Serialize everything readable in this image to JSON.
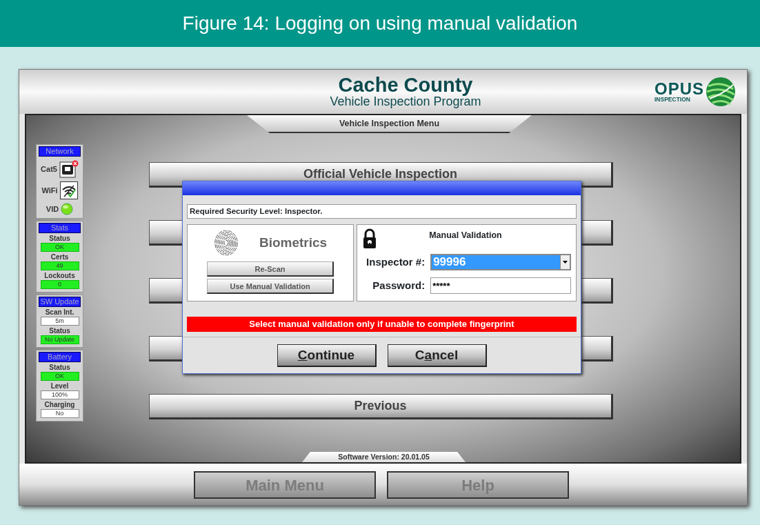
{
  "caption": "Figure 14: Logging on using manual validation",
  "header": {
    "title": "Cache County",
    "subtitle": "Vehicle Inspection Program",
    "logo_text": "OPUS",
    "logo_subtext": "INSPECTION"
  },
  "menu_title": "Vehicle Inspection Menu",
  "side_panel": [
    {
      "title": "Network",
      "rows": [
        {
          "kind": "port",
          "label": "Cat5",
          "error": true
        },
        {
          "kind": "wifi",
          "label": "WiFi",
          "connected": true
        },
        {
          "kind": "led",
          "label": "VID",
          "on": true
        }
      ]
    },
    {
      "title": "Stats",
      "rows": [
        {
          "kind": "value",
          "label": "Status",
          "value": "OK",
          "highlight": true
        },
        {
          "kind": "value",
          "label": "Certs",
          "value": "49",
          "highlight": true
        },
        {
          "kind": "value",
          "label": "Lockouts",
          "value": "0",
          "highlight": true
        }
      ]
    },
    {
      "title": "SW Update",
      "rows": [
        {
          "kind": "value",
          "label": "Scan Int.",
          "value": "5m",
          "highlight": false
        },
        {
          "kind": "value",
          "label": "Status",
          "value": "No Update",
          "highlight": true
        }
      ]
    },
    {
      "title": "Battery",
      "rows": [
        {
          "kind": "value",
          "label": "Status",
          "value": "OK",
          "highlight": true
        },
        {
          "kind": "value",
          "label": "Level",
          "value": "100%",
          "highlight": false
        },
        {
          "kind": "value",
          "label": "Charging",
          "value": "No",
          "highlight": false
        }
      ]
    }
  ],
  "menu_buttons": [
    {
      "kind": "labeled",
      "label": "Official Vehicle Inspection"
    },
    {
      "kind": "blank"
    },
    {
      "kind": "blank"
    },
    {
      "kind": "blank"
    },
    {
      "kind": "labeled",
      "label": "Previous"
    }
  ],
  "dialog": {
    "message": "Required Security Level: Inspector.",
    "biometrics_label": "Biometrics",
    "biometric_buttons": [
      "Re-Scan",
      "Use Manual Validation"
    ],
    "manual_title": "Manual Validation",
    "inspector_label": "Inspector #:",
    "inspector_value": "99996",
    "password_label": "Password:",
    "password_value": "*****",
    "warning": "Select manual validation only if unable to complete fingerprint",
    "actions": [
      {
        "key": "C",
        "after": "ontinue"
      },
      {
        "before": "C",
        "key": "a",
        "after": "ncel"
      }
    ]
  },
  "version": "Software Version: 20.01.05",
  "footer_buttons": [
    {
      "label": "Main Menu",
      "disabled": true
    },
    {
      "label": "Help",
      "disabled": true
    }
  ]
}
